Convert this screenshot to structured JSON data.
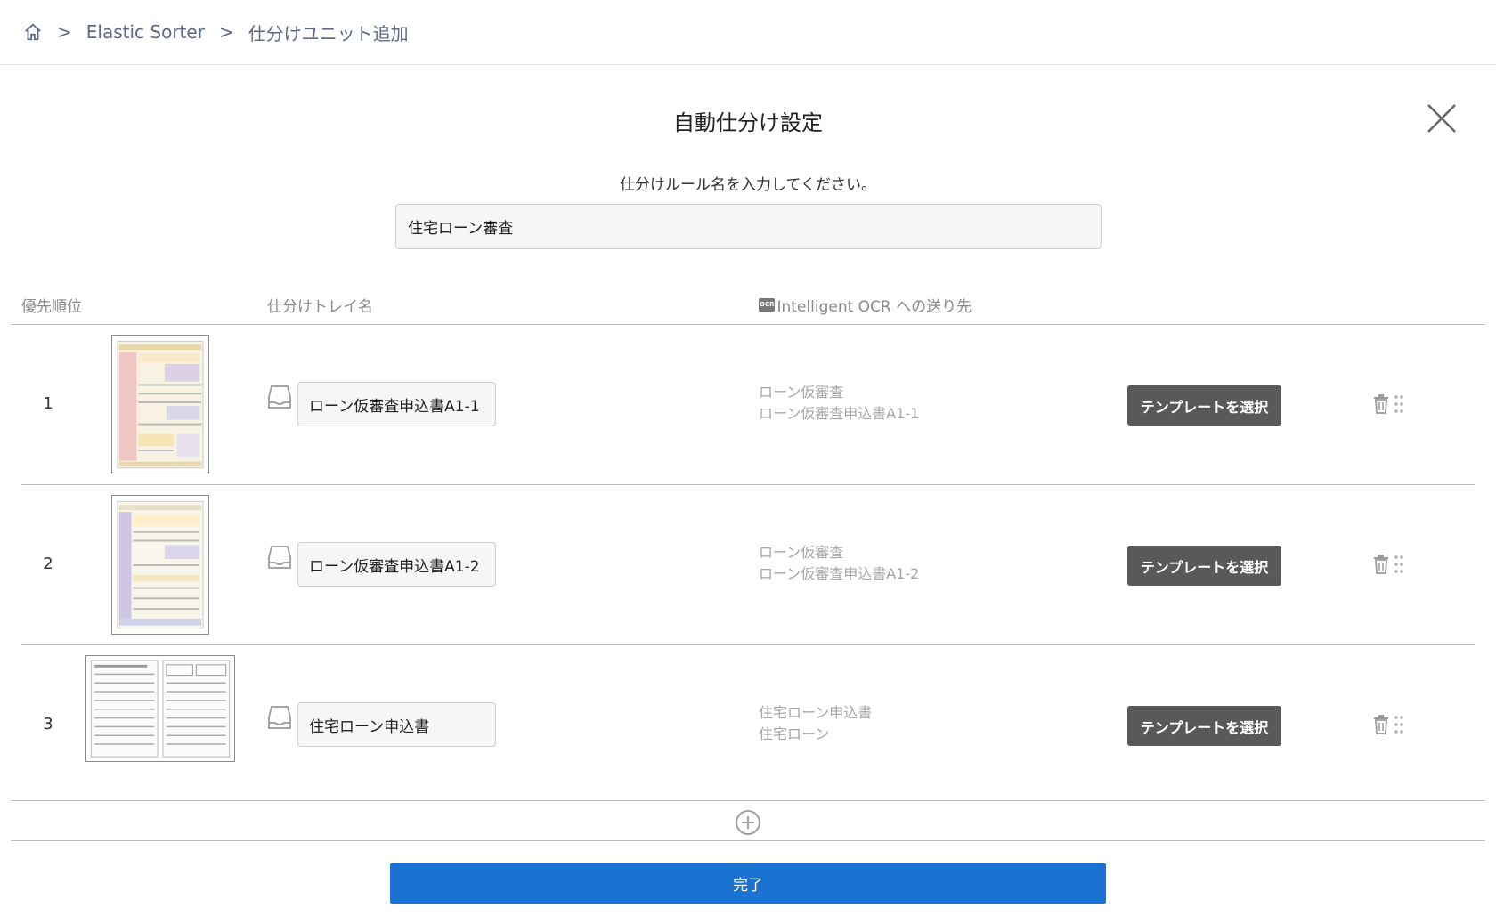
{
  "breadcrumb": {
    "items": [
      "Elastic Sorter",
      "仕分けユニット追加"
    ],
    "separator": ">"
  },
  "dialog": {
    "title": "自動仕分け設定",
    "prompt": "仕分けルール名を入力してください。",
    "rule_name": "住宅ローン審査"
  },
  "table": {
    "headers": {
      "priority": "優先順位",
      "tray_name": "仕分けトレイ名",
      "ocr_badge": "OCR",
      "ocr_destination": "Intelligent OCR への送り先"
    },
    "rows": [
      {
        "priority": "1",
        "tray_name": "ローン仮審査申込書A1-1",
        "dest_line1": "ローン仮審査",
        "dest_line2": "ローン仮審査申込書A1-1",
        "button": "テンプレートを選択"
      },
      {
        "priority": "2",
        "tray_name": "ローン仮審査申込書A1-2",
        "dest_line1": "ローン仮審査",
        "dest_line2": "ローン仮審査申込書A1-2",
        "button": "テンプレートを選択"
      },
      {
        "priority": "3",
        "tray_name": "住宅ローン申込書",
        "dest_line1": "住宅ローン申込書",
        "dest_line2": "住宅ローン",
        "button": "テンプレートを選択"
      }
    ]
  },
  "footer": {
    "done_label": "完了"
  },
  "colors": {
    "primary": "#1a73d2",
    "template_button": "#595959",
    "breadcrumb": "#5d6a86"
  }
}
